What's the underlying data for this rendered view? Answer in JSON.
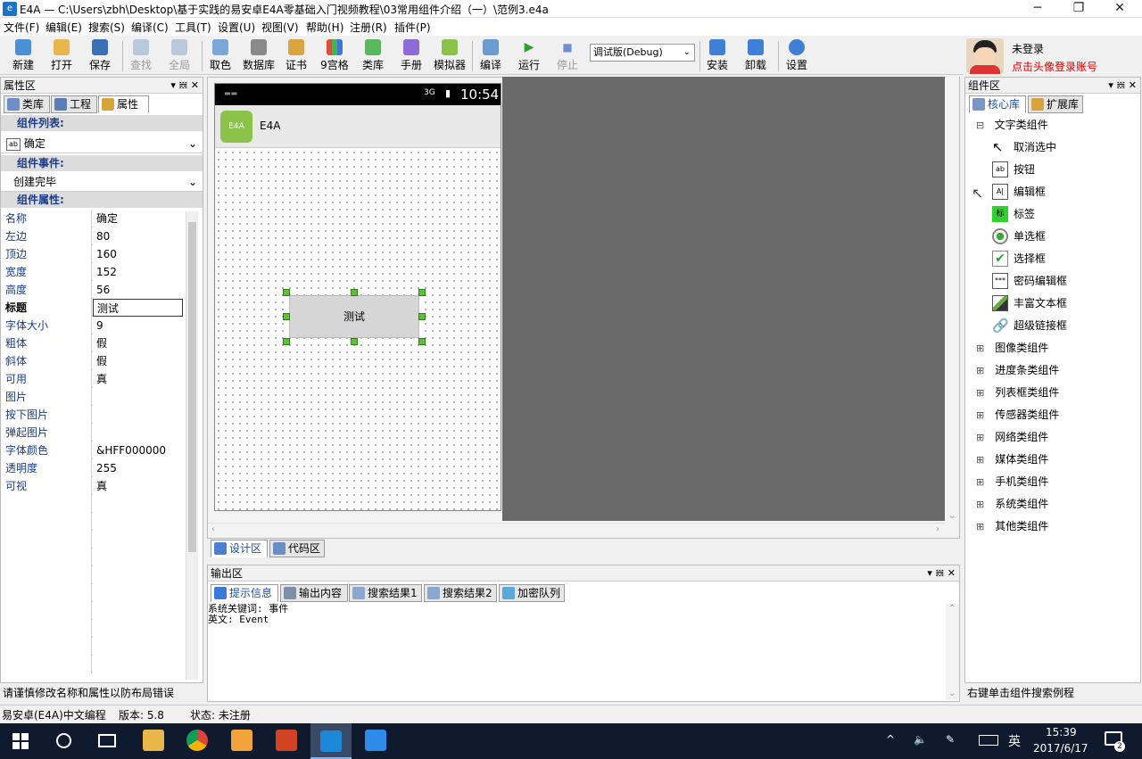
{
  "window": {
    "app_icon": "e4a-icon",
    "title": "E4A — C:\\Users\\zbh\\Desktop\\基于实践的易安卓E4A零基础入门视频教程\\03常用组件介绍（一）\\范例3.e4a",
    "minimize": "─",
    "maximize": "❐",
    "close": "✕"
  },
  "menu": [
    "文件(F)",
    "编辑(E)",
    "搜索(S)",
    "编译(C)",
    "工具(T)",
    "设置(U)",
    "视图(V)",
    "帮助(H)",
    "注册(R)",
    "插件(P)"
  ],
  "toolbar": {
    "new": "新建",
    "open": "打开",
    "save": "保存",
    "find": "查找",
    "all": "全局",
    "pick_color": "取色",
    "database": "数据库",
    "cert": "证书",
    "grid9": "9宫格",
    "library": "类库",
    "manual": "手册",
    "emulator": "模拟器",
    "compile": "编译",
    "run": "运行",
    "stop": "停止",
    "build_mode": "调试版(Debug)",
    "install": "安装",
    "uninstall": "卸载",
    "settings": "设置"
  },
  "user": {
    "status": "未登录",
    "login_hint": "点击头像登录账号",
    "login_hint_color": "#e00000"
  },
  "left_panel": {
    "title": "属性区",
    "tabs": [
      "类库",
      "工程",
      "属性"
    ],
    "component_list_label": "组件列表:",
    "component_selected": "确定",
    "component_event_label": "组件事件:",
    "event_selected": "创建完毕",
    "component_props_label": "组件属性:",
    "props": [
      [
        "名称",
        "确定"
      ],
      [
        "左边",
        "80"
      ],
      [
        "顶边",
        "160"
      ],
      [
        "宽度",
        "152"
      ],
      [
        "高度",
        "56"
      ],
      [
        "标题",
        "测试"
      ],
      [
        "字体大小",
        "9"
      ],
      [
        "粗体",
        "假"
      ],
      [
        "斜体",
        "假"
      ],
      [
        "可用",
        "真"
      ],
      [
        "图片",
        ""
      ],
      [
        "按下图片",
        ""
      ],
      [
        "弹起图片",
        ""
      ],
      [
        "字体颜色",
        "&HFF000000"
      ],
      [
        "透明度",
        "255"
      ],
      [
        "可视",
        "真"
      ]
    ],
    "hint": "请谨慎修改名称和属性以防布局错误"
  },
  "design": {
    "status_time": "10:54",
    "signal": "3G",
    "app_title": "E4A",
    "app_icon_text": "E4A",
    "button_text": "测试",
    "tabs": [
      "设计区",
      "代码区"
    ]
  },
  "output": {
    "title": "输出区",
    "tabs": [
      "提示信息",
      "输出内容",
      "搜索结果1",
      "搜索结果2",
      "加密队列"
    ],
    "lines": [
      "系统关键词: 事件",
      "英文: Event"
    ]
  },
  "right_panel": {
    "title": "组件区",
    "tabs": [
      "核心库",
      "扩展库"
    ],
    "expanded_group": "文字类组件",
    "expanded_items": [
      "取消选中",
      "按钮",
      "编辑框",
      "标签",
      "单选框",
      "选择框",
      "密码编辑框",
      "丰富文本框",
      "超级链接框"
    ],
    "icon_labels": {
      "button": "ab",
      "edit": "A|",
      "label": "标",
      "password": "***"
    },
    "groups": [
      "图像类组件",
      "进度条类组件",
      "列表框类组件",
      "传感器类组件",
      "网络类组件",
      "媒体类组件",
      "手机类组件",
      "系统类组件",
      "其他类组件"
    ],
    "hint": "右键单击组件搜索例程"
  },
  "statusbar": {
    "left": "易安卓(E4A)中文编程",
    "version": "版本: 5.8",
    "state": "状态: 未注册"
  },
  "taskbar": {
    "time": "15:39",
    "date": "2017/6/17",
    "ime": "英",
    "notif_count": "2"
  }
}
